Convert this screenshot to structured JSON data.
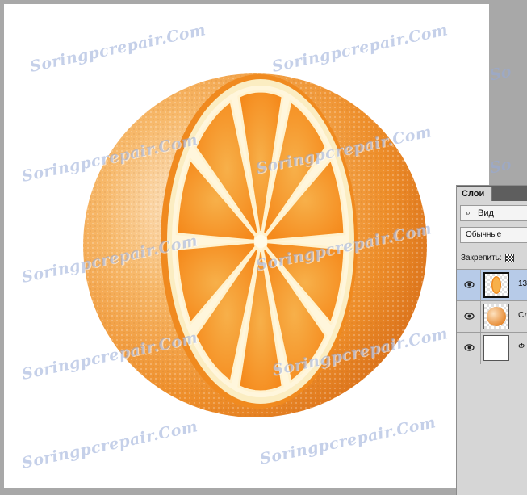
{
  "watermark": {
    "text": "Soringpcrepair.Com"
  },
  "layers_panel": {
    "tab_label": "Слои",
    "filter_label": "Вид",
    "blend_mode": "Обычные",
    "lock_label": "Закрепить:",
    "layers": [
      {
        "name": "13",
        "selected": true,
        "thumb": "orange-slice"
      },
      {
        "name": "Сл",
        "selected": false,
        "thumb": "orange-sphere"
      },
      {
        "name": "Ф",
        "selected": false,
        "thumb": "white"
      }
    ]
  },
  "colors": {
    "canvas_bg": "#a8a8a8",
    "document_bg": "#ffffff",
    "orange_peel": "#f0902a",
    "orange_flesh": "#f7a23a",
    "pith": "#fbf0c8",
    "selection": "#b7cbe8"
  }
}
